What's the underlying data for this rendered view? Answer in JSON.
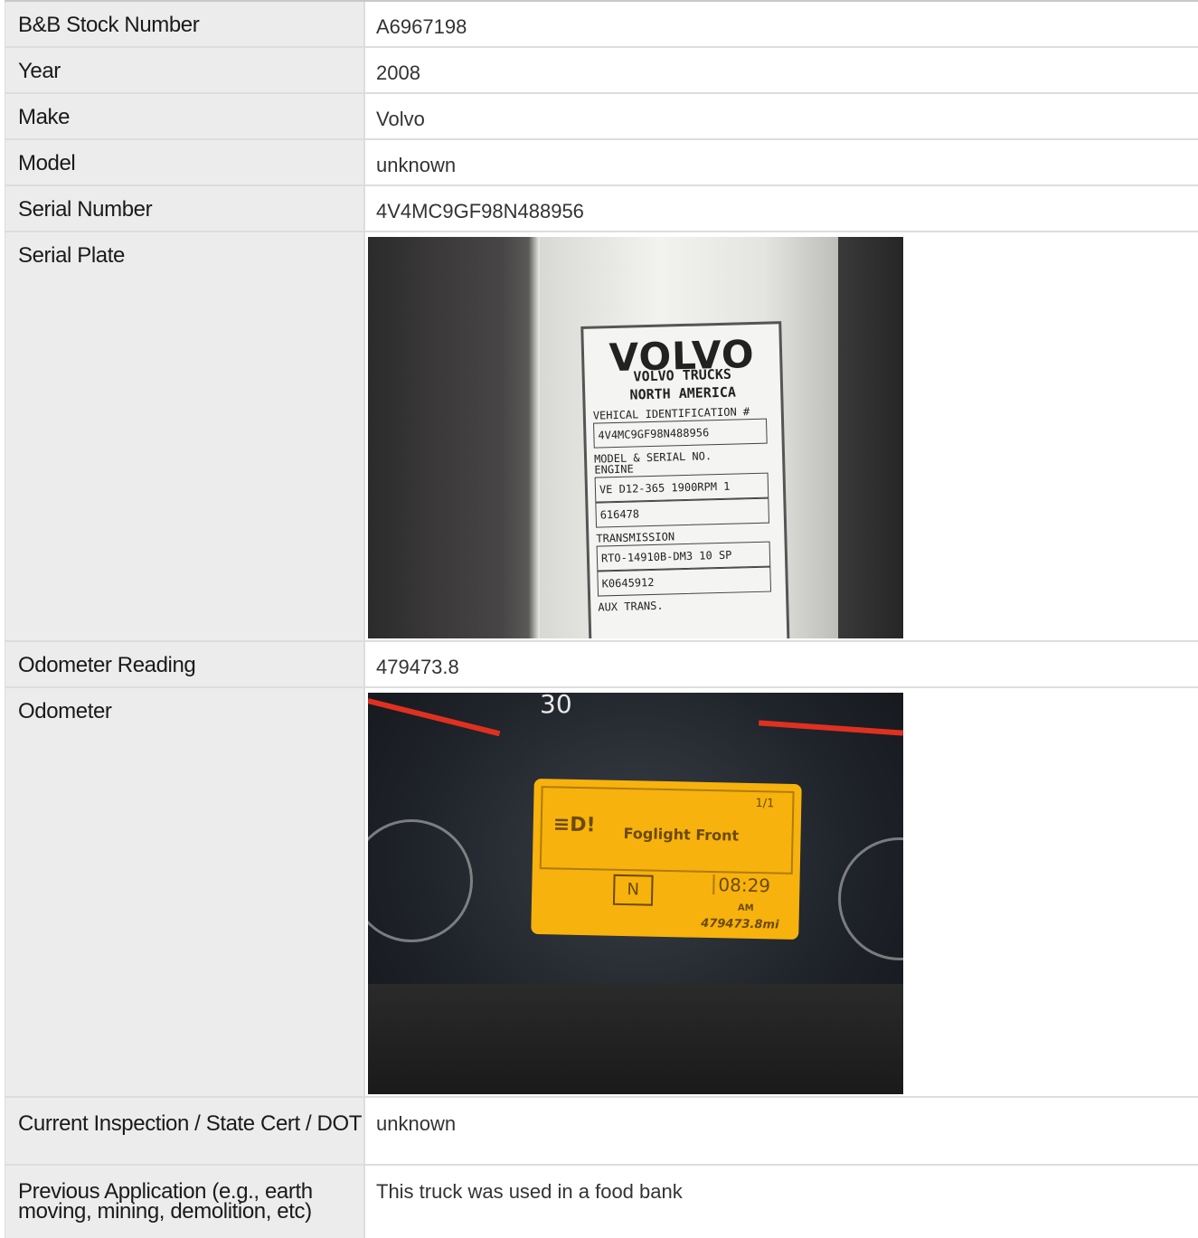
{
  "rows": [
    {
      "label": "B&B Stock Number",
      "value": "A6967198"
    },
    {
      "label": "Year",
      "value": "2008"
    },
    {
      "label": "Make",
      "value": "Volvo"
    },
    {
      "label": "Model",
      "value": "unknown"
    },
    {
      "label": "Serial Number",
      "value": "4V4MC9GF98N488956"
    },
    {
      "label": "Serial Plate"
    },
    {
      "label": "Odometer Reading",
      "value": "479473.8"
    },
    {
      "label": "Odometer"
    },
    {
      "label": "Current Inspection / State Cert / DOT",
      "value": "unknown"
    },
    {
      "label": "Previous Application (e.g., earth moving, mining, demolition, etc)",
      "value": "This truck was used in a food bank"
    }
  ],
  "serial_plate_photo": {
    "brand": "VOLVO",
    "line1": "VOLVO TRUCKS",
    "line2": "NORTH AMERICA",
    "vin_label": "VEHICAL IDENTIFICATION #",
    "vin": "4V4MC9GF98N488956",
    "engine_label1": "MODEL & SERIAL NO.",
    "engine_label2": "ENGINE",
    "engine_model": "VE D12-365 1900RPM 1",
    "engine_serial": "616478",
    "trans_label": "TRANSMISSION",
    "trans_model": "RTO-14910B-DM3 10 SP",
    "trans_serial": "K0645912",
    "aux_label": "AUX TRANS."
  },
  "odometer_photo": {
    "speed_mark": "30",
    "page_indicator": "1/1",
    "warning_symbol": "≡D!",
    "message": "Foglight Front",
    "gear": "N",
    "clock": "08:29",
    "ampm": "AM",
    "odometer": "479473.8mi"
  }
}
